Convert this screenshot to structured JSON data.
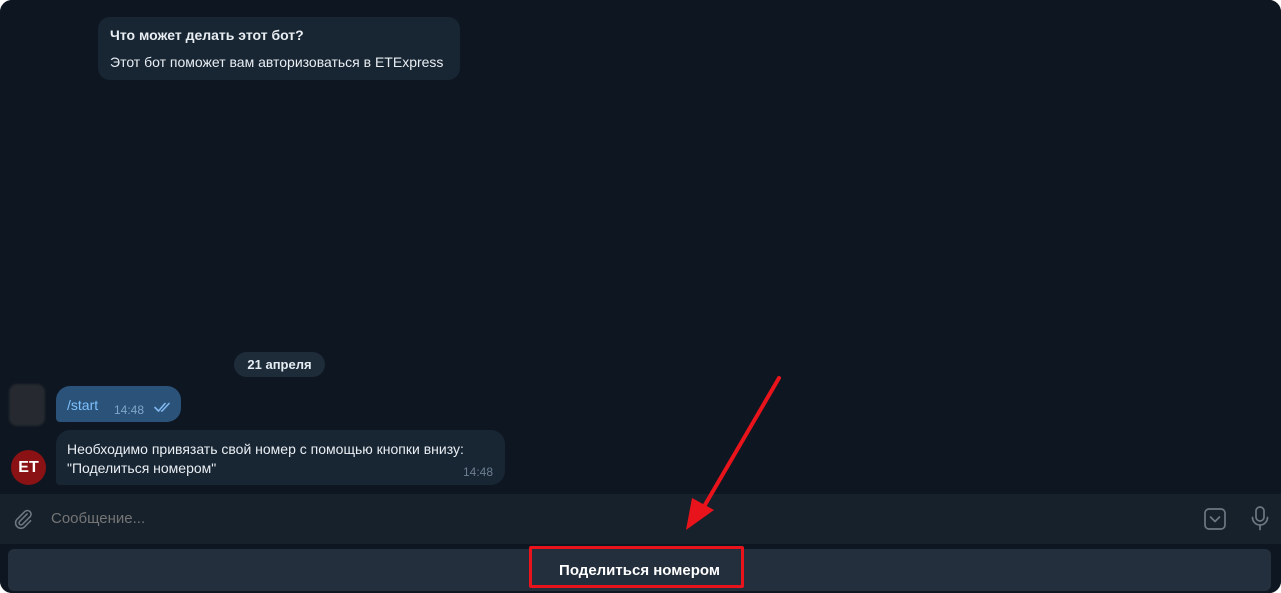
{
  "bot_info": {
    "title": "Что может делать этот бот?",
    "description": "Этот бот поможет вам авторизоваться в ETExpress"
  },
  "date_separator": "21 апреля",
  "messages": [
    {
      "direction": "outgoing",
      "text": "/start",
      "time": "14:48",
      "status": "read"
    },
    {
      "direction": "incoming",
      "sender_avatar": "ET",
      "text_line1": "Необходимо привязать свой номер с помощью кнопки внизу:",
      "text_line2": "\"Поделиться номером\"",
      "time": "14:48"
    }
  ],
  "composer": {
    "placeholder": "Сообщение...",
    "icons": [
      "paperclip-icon",
      "keyboard-icon",
      "microphone-icon"
    ]
  },
  "reply_keyboard": {
    "button_label": "Поделиться номером"
  },
  "colors": {
    "background": "#0e1621",
    "incoming_bubble": "#182533",
    "outgoing_bubble": "#2b5278",
    "annotation_red": "#e8131b",
    "bot_avatar": "#8b1214"
  }
}
